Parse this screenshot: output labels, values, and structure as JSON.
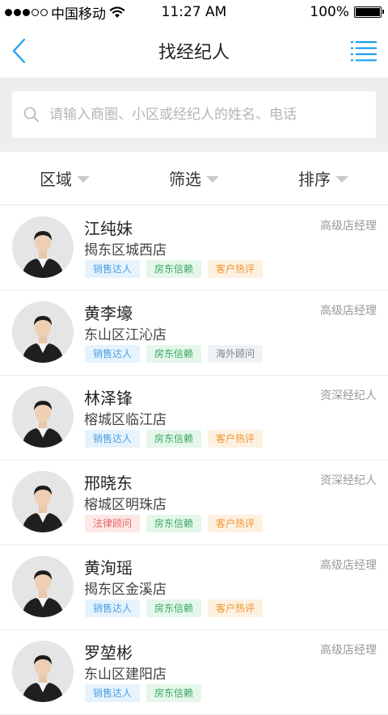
{
  "status_bar": {
    "carrier": "中国移动",
    "time": "11:27 AM",
    "battery": "100%"
  },
  "nav": {
    "title": "找经纪人",
    "back_icon": "chevron-left-icon",
    "menu_icon": "list-menu-icon"
  },
  "search": {
    "placeholder": "请输入商圈、小区或经纪人的姓名、电话",
    "value": ""
  },
  "filters": [
    {
      "label": "区域"
    },
    {
      "label": "筛选"
    },
    {
      "label": "排序"
    }
  ],
  "colors": {
    "accent": "#1a9ff0",
    "tag_sales_bg": "#e6f3fd",
    "tag_sales_fg": "#4a9fe8",
    "tag_landlord_bg": "#e4f7ea",
    "tag_landlord_fg": "#3aa765",
    "tag_hot_bg": "#fdf1e2",
    "tag_hot_fg": "#f0952e",
    "tag_overseas_bg": "#f0f2f4",
    "tag_overseas_fg": "#7a8590",
    "tag_legal_bg": "#fde8e8",
    "tag_legal_fg": "#e8635e"
  },
  "agents": [
    {
      "name": "江纯妹",
      "store": "揭东区城西店",
      "title": "高级店经理",
      "tags": [
        {
          "label": "销售达人",
          "type": "sales"
        },
        {
          "label": "房东信赖",
          "type": "landlord"
        },
        {
          "label": "客户热评",
          "type": "hot"
        }
      ]
    },
    {
      "name": "黄李壕",
      "store": "东山区江沁店",
      "title": "高级店经理",
      "tags": [
        {
          "label": "销售达人",
          "type": "sales"
        },
        {
          "label": "房东信赖",
          "type": "landlord"
        },
        {
          "label": "海外顾问",
          "type": "overseas"
        }
      ]
    },
    {
      "name": "林泽锋",
      "store": "榕城区临江店",
      "title": "资深经纪人",
      "tags": [
        {
          "label": "销售达人",
          "type": "sales"
        },
        {
          "label": "房东信赖",
          "type": "landlord"
        },
        {
          "label": "客户热评",
          "type": "hot"
        }
      ]
    },
    {
      "name": "邢晓东",
      "store": "榕城区明珠店",
      "title": "资深经纪人",
      "tags": [
        {
          "label": "法律顾问",
          "type": "legal"
        },
        {
          "label": "房东信赖",
          "type": "landlord"
        },
        {
          "label": "客户热评",
          "type": "hot"
        }
      ]
    },
    {
      "name": "黄洵瑶",
      "store": "揭东区金溪店",
      "title": "高级店经理",
      "tags": [
        {
          "label": "销售达人",
          "type": "sales"
        },
        {
          "label": "房东信赖",
          "type": "landlord"
        },
        {
          "label": "客户热评",
          "type": "hot"
        }
      ]
    },
    {
      "name": "罗堃彬",
      "store": "东山区建阳店",
      "title": "高级店经理",
      "tags": [
        {
          "label": "销售达人",
          "type": "sales"
        },
        {
          "label": "房东信赖",
          "type": "landlord"
        }
      ]
    }
  ]
}
